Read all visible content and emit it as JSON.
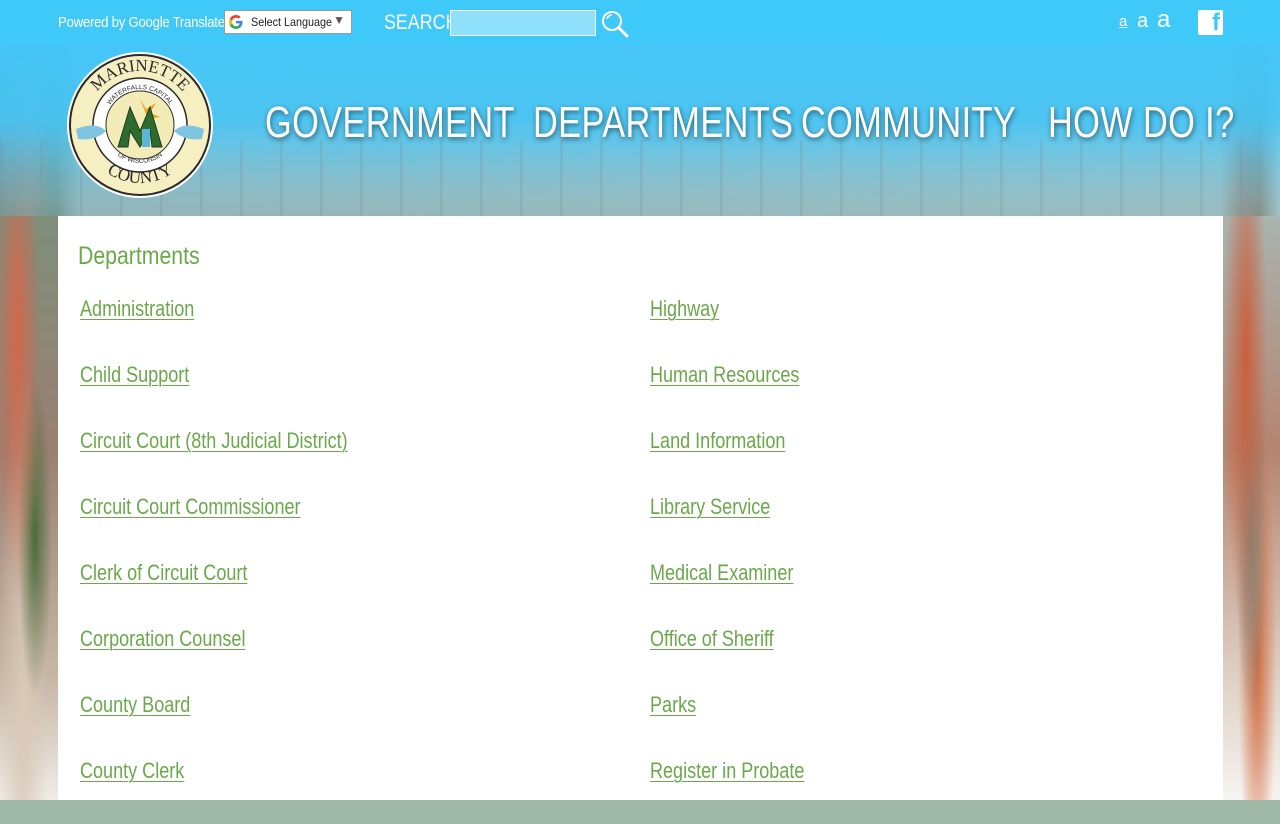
{
  "topbar": {
    "translate_label": "Powered by Google Translate",
    "language_select": "Select Language",
    "search_label": "SEARCH",
    "search_value": "",
    "text_size_small": "a",
    "text_size_medium": "a",
    "text_size_large": "a",
    "facebook_icon": "facebook-icon"
  },
  "logo": {
    "top_text": "MARINETTE",
    "bottom_text": "COUNTY",
    "inner_top": "WATERFALLS CAPITAL",
    "inner_bottom": "OF WISCONSIN"
  },
  "nav": {
    "government": "GOVERNMENT",
    "departments": "DEPARTMENTS",
    "community": "COMMUNITY",
    "how_do_i": "HOW DO I?"
  },
  "content": {
    "title": "Departments",
    "left_links": [
      "Administration",
      "Child Support",
      "Circuit Court (8th Judicial District)",
      "Circuit Court Commissioner",
      "Clerk of Circuit Court",
      "Corporation Counsel",
      "County Board",
      "County Clerk"
    ],
    "right_links": [
      "Highway",
      "Human Resources",
      "Land Information",
      "Library Service",
      "Medical Examiner",
      "Office of Sheriff",
      "Parks",
      "Register in Probate"
    ]
  },
  "colors": {
    "topbar": "#3fc9f8",
    "link_green": "#6aa84a",
    "panel": "#ffffff"
  }
}
